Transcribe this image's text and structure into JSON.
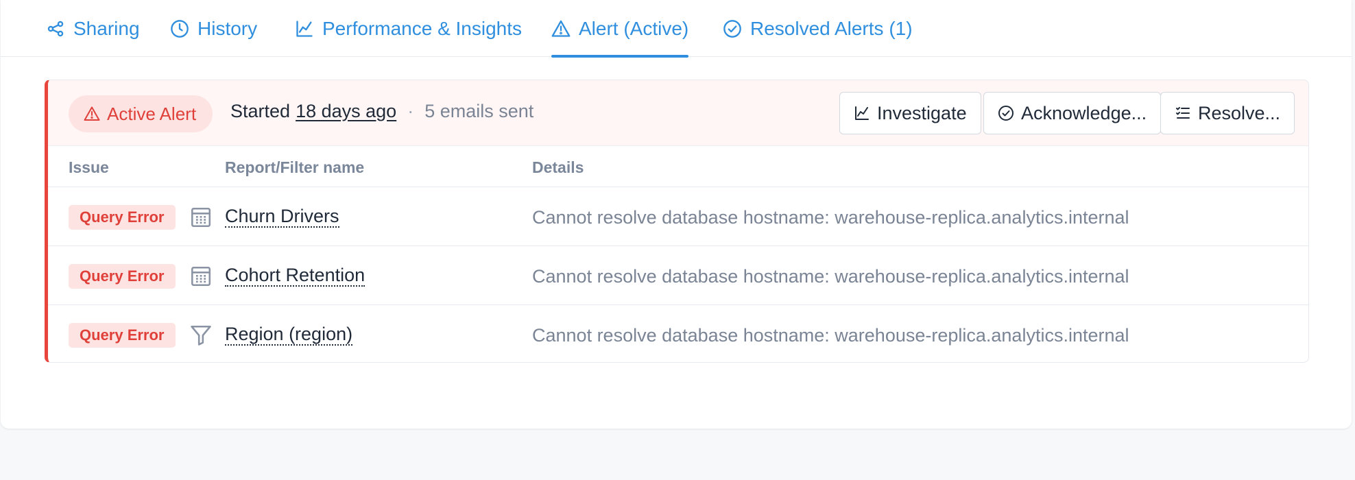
{
  "tabs": [
    {
      "label": "Sharing",
      "icon": "share-icon"
    },
    {
      "label": "History",
      "icon": "clock-icon"
    },
    {
      "label": "Performance & Insights",
      "icon": "line-chart-icon"
    },
    {
      "label": "Alert (Active)",
      "icon": "warning-icon",
      "active": true
    },
    {
      "label": "Resolved Alerts (1)",
      "icon": "check-circle-icon"
    }
  ],
  "alert": {
    "badge": "Active Alert",
    "started_prefix": "Started",
    "started_ago": "18 days ago",
    "separator": "·",
    "emails": "5 emails sent",
    "actions": {
      "investigate": "Investigate",
      "acknowledge": "Acknowledge...",
      "resolve": "Resolve..."
    }
  },
  "table": {
    "columns": [
      "Issue",
      "Report/Filter name",
      "Details"
    ],
    "rows": [
      {
        "issue": "Query Error",
        "icon": "table-icon",
        "name": "Churn Drivers",
        "details": "Cannot resolve database hostname: warehouse-replica.analytics.internal"
      },
      {
        "issue": "Query Error",
        "icon": "table-icon",
        "name": "Cohort Retention",
        "details": "Cannot resolve database hostname: warehouse-replica.analytics.internal"
      },
      {
        "issue": "Query Error",
        "icon": "filter-icon",
        "name": "Region (region)",
        "details": "Cannot resolve database hostname: warehouse-replica.analytics.internal"
      }
    ]
  },
  "colors": {
    "accent": "#2f8fde",
    "alert_red": "#e8453c",
    "alert_bg": "#fff6f5",
    "badge_bg": "#fde4e2"
  }
}
